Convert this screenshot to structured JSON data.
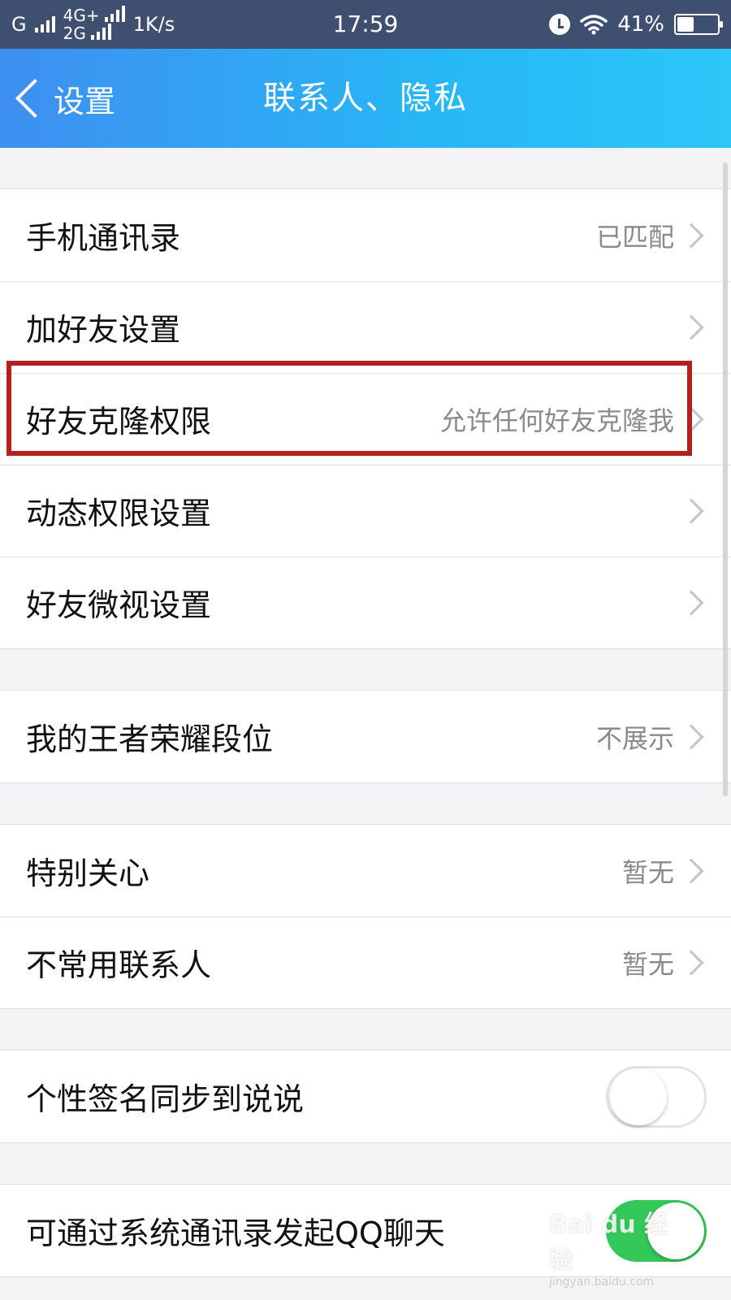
{
  "status_bar": {
    "carrier1": "G",
    "carrier2_top": "4G+",
    "carrier2_bottom": "2G",
    "speed": "1K/s",
    "time": "17:59",
    "battery": "41%",
    "battery_level": 0.41,
    "icons": [
      "signal-icon",
      "alarm-icon",
      "wifi-icon",
      "battery-icon"
    ]
  },
  "nav": {
    "back_label": "设置",
    "title": "联系人、隐私"
  },
  "groups": [
    {
      "items": [
        {
          "label": "手机通讯录",
          "value": "已匹配",
          "chevron": true
        },
        {
          "label": "加好友设置",
          "value": "",
          "chevron": true
        },
        {
          "label": "好友克隆权限",
          "value": "允许任何好友克隆我",
          "chevron": true,
          "highlighted": true
        },
        {
          "label": "动态权限设置",
          "value": "",
          "chevron": true
        },
        {
          "label": "好友微视设置",
          "value": "",
          "chevron": true
        }
      ]
    },
    {
      "items": [
        {
          "label": "我的王者荣耀段位",
          "value": "不展示",
          "chevron": true
        }
      ]
    },
    {
      "items": [
        {
          "label": "特别关心",
          "value": "暂无",
          "chevron": true
        },
        {
          "label": "不常用联系人",
          "value": "暂无",
          "chevron": true
        }
      ]
    },
    {
      "items": [
        {
          "label": "个性签名同步到说说",
          "toggle": false
        }
      ]
    },
    {
      "items": [
        {
          "label": "可通过系统通讯录发起QQ聊天",
          "toggle": true
        }
      ]
    }
  ],
  "highlight_color": "#b3201d",
  "accent_color": "#34c759",
  "watermark": {
    "main": "Bai du 经验",
    "sub": "jingyan.baidu.com"
  }
}
